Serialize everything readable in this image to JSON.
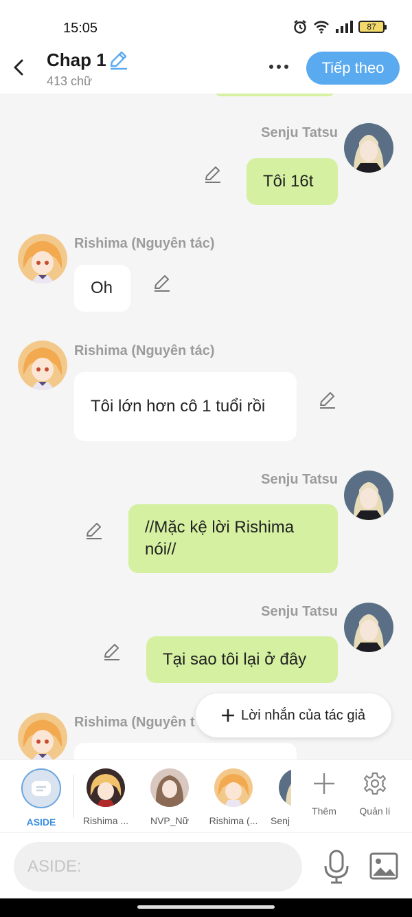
{
  "status": {
    "time": "15:05",
    "battery": "87"
  },
  "header": {
    "title": "Chap 1",
    "word_count": "413 chữ",
    "next_label": "Tiếp theo"
  },
  "messages": [
    {
      "sender": "Senju Tatsu",
      "text": "Tôi 16t",
      "side": "right"
    },
    {
      "sender": "Rishima (Nguyên tác)",
      "text": "Oh",
      "side": "left"
    },
    {
      "sender": "Rishima (Nguyên tác)",
      "text": "Tôi lớn hơn cô 1 tuổi rồi",
      "side": "left"
    },
    {
      "sender": "Senju Tatsu",
      "text": "//Mặc kệ lời Rishima nói//",
      "side": "right"
    },
    {
      "sender": "Senju Tatsu",
      "text": "Tại sao tôi lại ở đây",
      "side": "right"
    },
    {
      "sender": "Rishima (Nguyên t",
      "text": "",
      "side": "left"
    }
  ],
  "author_note": {
    "label": "Lời nhắn của tác giả"
  },
  "characters": [
    {
      "label": "ASIDE",
      "selected": true
    },
    {
      "label": "Rishima ..."
    },
    {
      "label": "NVP_Nữ"
    },
    {
      "label": "Rishima (..."
    },
    {
      "label": "Senj"
    }
  ],
  "tools": {
    "add_label": "Thêm",
    "manage_label": "Quản lí"
  },
  "input": {
    "placeholder": "ASIDE:"
  },
  "colors": {
    "accent": "#5aaaf0",
    "bubble_green": "#d4f0a0",
    "bubble_white": "#ffffff",
    "aside_selected": "#3a8ee0"
  }
}
